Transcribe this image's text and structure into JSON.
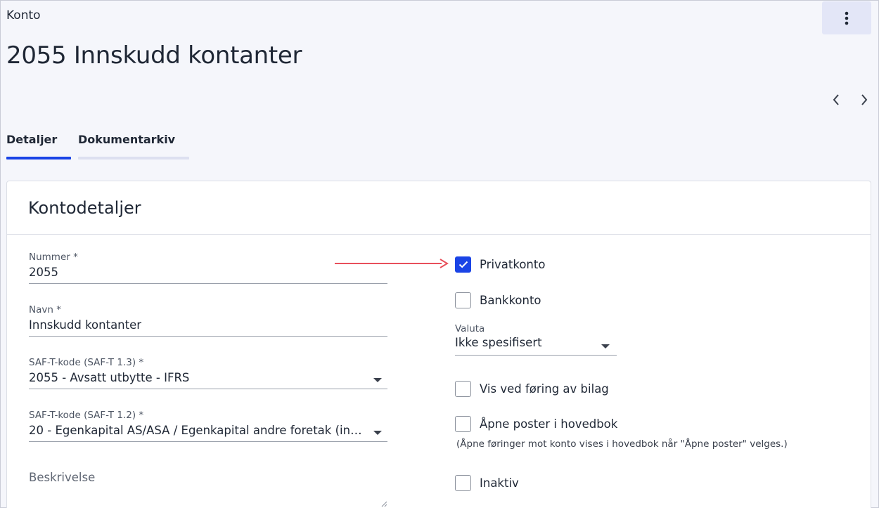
{
  "breadcrumb": "Konto",
  "page_title": "2055 Innskudd kontanter",
  "tabs": [
    {
      "label": "Detaljer",
      "active": true
    },
    {
      "label": "Dokumentarkiv",
      "active": false
    }
  ],
  "card": {
    "title": "Kontodetaljer",
    "fields": {
      "nummer": {
        "label": "Nummer *",
        "value": "2055"
      },
      "navn": {
        "label": "Navn *",
        "value": "Innskudd kontanter"
      },
      "saft13": {
        "label": "SAF-T-kode (SAF-T 1.3) *",
        "value": "2055 - Avsatt utbytte - IFRS"
      },
      "saft12": {
        "label": "SAF-T-kode (SAF-T 1.2) *",
        "value": "20 - Egenkapital AS/ASA / Egenkapital andre foretak (ink…"
      },
      "beskrivelse": {
        "placeholder": "Beskrivelse"
      }
    },
    "checkboxes": {
      "privatkonto": {
        "label": "Privatkonto",
        "checked": true
      },
      "bankkonto": {
        "label": "Bankkonto",
        "checked": false
      },
      "vis_ved_foring": {
        "label": "Vis ved føring av bilag",
        "checked": false
      },
      "apne_poster": {
        "label": "Åpne poster i hovedbok",
        "checked": false,
        "hint": "(Åpne føringer mot konto vises i hovedbok når \"Åpne poster\" velges.)"
      },
      "inaktiv": {
        "label": "Inaktiv",
        "checked": false
      }
    },
    "valuta": {
      "label": "Valuta",
      "value": "Ikke spesifisert"
    }
  },
  "colors": {
    "accent": "#1a44e6",
    "arrow": "#e8505b",
    "background": "#f5f6fb",
    "tab_inactive_underline": "#dde0f0"
  },
  "icons": {
    "menu": "more-vertical-icon",
    "prev": "chevron-left-icon",
    "next": "chevron-right-icon"
  }
}
